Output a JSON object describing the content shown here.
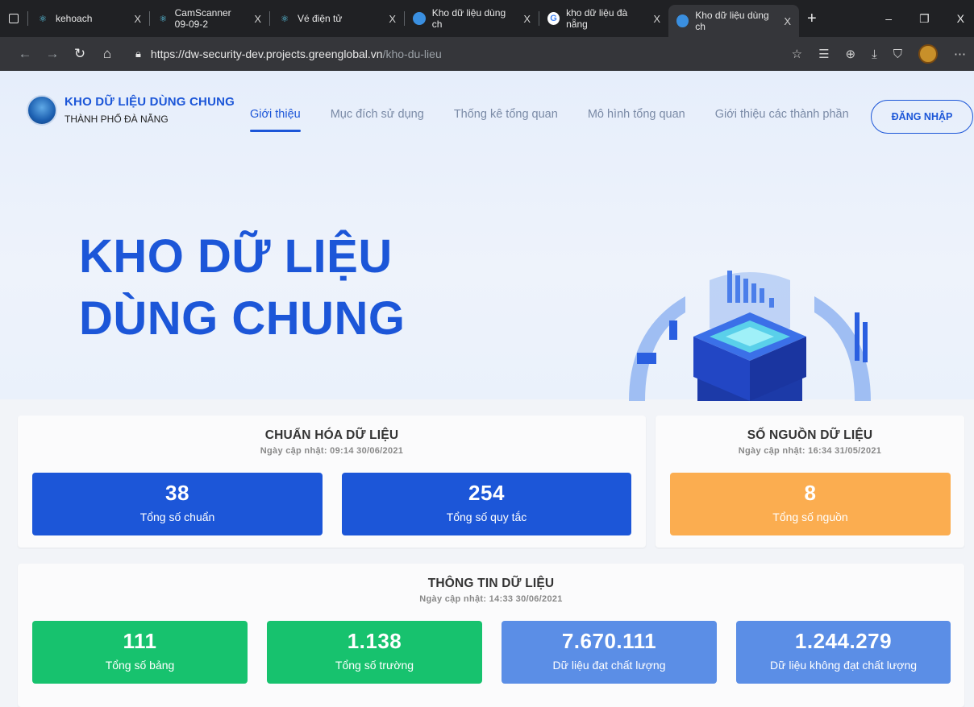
{
  "browser": {
    "tabs": [
      {
        "title": "kehoach",
        "icon": "react-icon"
      },
      {
        "title": "CamScanner 09-09-2",
        "icon": "react-icon"
      },
      {
        "title": "Vé điện tử",
        "icon": "react-icon"
      },
      {
        "title": "Kho dữ liệu dùng ch",
        "icon": "site-icon"
      },
      {
        "title": "kho dữ liệu đà nẵng",
        "icon": "google-icon"
      },
      {
        "title": "Kho dữ liệu dùng ch",
        "icon": "site-icon"
      }
    ],
    "active_tab_index": 5,
    "url_host": "https://dw-security-dev.projects.greenglobal.vn",
    "url_path": "/kho-du-lieu"
  },
  "nav": {
    "brand_title": "KHO DỮ LIỆU DÙNG CHUNG",
    "brand_subtitle": "THÀNH PHỐ ĐÀ NẴNG",
    "menu": [
      "Giới thiệu",
      "Mục đích sử dụng",
      "Thống kê tổng quan",
      "Mô hình tổng quan",
      "Giới thiệu các thành phần"
    ],
    "login_label": "ĐĂNG NHẬP"
  },
  "hero": {
    "line1": "KHO DỮ LIỆU",
    "line2": "DÙNG CHUNG"
  },
  "standardization": {
    "title": "CHUẨN HÓA DỮ LIỆU",
    "updated": "Ngày cập nhật: 09:14 30/06/2021",
    "stats": [
      {
        "value": "38",
        "label": "Tổng số chuẩn",
        "color": "#1c56d8"
      },
      {
        "value": "254",
        "label": "Tổng số quy tắc",
        "color": "#1c56d8"
      }
    ]
  },
  "sources": {
    "title": "SỐ NGUỒN DỮ LIỆU",
    "updated": "Ngày cập nhật: 16:34 31/05/2021",
    "stats": [
      {
        "value": "8",
        "label": "Tổng số nguồn",
        "color": "#fbad50"
      }
    ]
  },
  "data_info": {
    "title": "THÔNG TIN DỮ LIỆU",
    "updated": "Ngày cập nhật: 14:33 30/06/2021",
    "stats": [
      {
        "value": "111",
        "label": "Tổng số bảng",
        "color": "#17c26e"
      },
      {
        "value": "1.138",
        "label": "Tổng số trường",
        "color": "#17c26e"
      },
      {
        "value": "7.670.111",
        "label": "Dữ liệu đạt chất lượng",
        "color": "#5b8ee6"
      },
      {
        "value": "1.244.279",
        "label": "Dữ liệu không đạt chất lượng",
        "color": "#5b8ee6"
      }
    ]
  }
}
